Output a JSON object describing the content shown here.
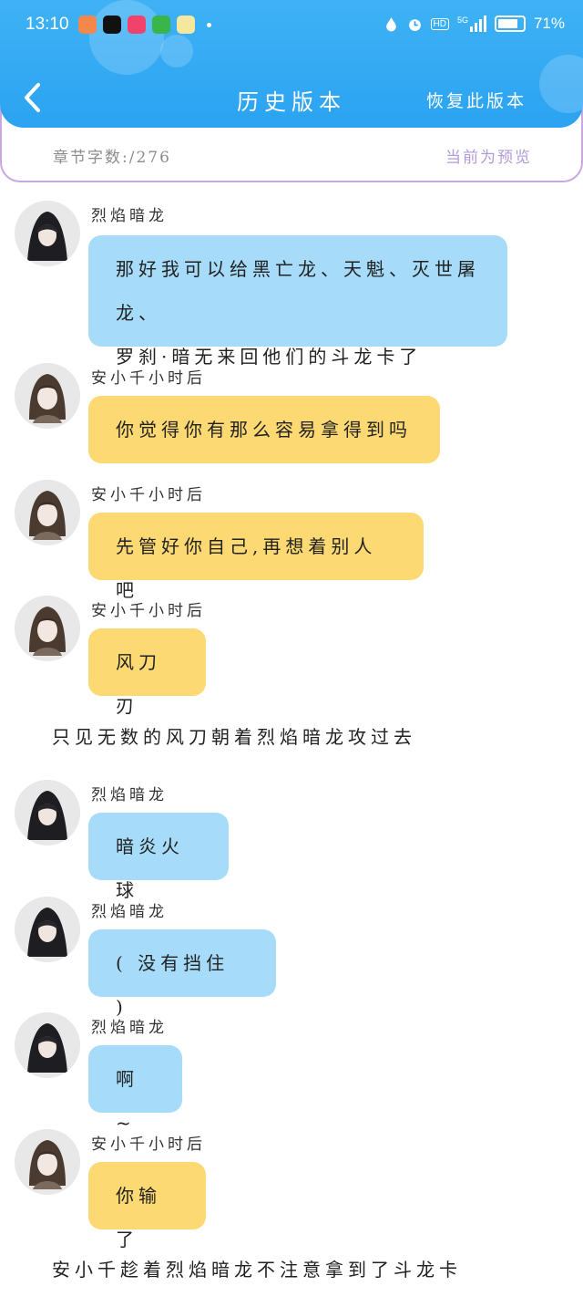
{
  "status_bar": {
    "time": "13:10",
    "battery_percent": "71%",
    "network": "5G",
    "hd_label": "HD",
    "battery_level": 0.71
  },
  "header": {
    "title": "历史版本",
    "restore_label": "恢复此版本",
    "back_icon": "chevron-left-icon"
  },
  "info": {
    "word_count": "章节字数:/276",
    "preview_label": "当前为预览"
  },
  "messages": [
    {
      "type": "chat",
      "speaker": "烈焰暗龙",
      "text": "那好我可以给黑亡龙、天魁、灭世屠龙、罗刹·暗无来回他们的斗龙卡了",
      "line1": "那好我可以给黑亡龙、天魁、灭世屠龙、",
      "line2": "罗刹·暗无来回他们的斗龙卡了",
      "color": "#a6dcfa"
    },
    {
      "type": "chat",
      "speaker": "安小千小时后",
      "text": "你觉得你有那么容易拿得到吗",
      "color": "#fcd972"
    },
    {
      "type": "chat",
      "speaker": "安小千小时后",
      "text": "先管好你自己,再想着别人吧",
      "color": "#fcd972"
    },
    {
      "type": "chat",
      "speaker": "安小千小时后",
      "text": "风刀刃",
      "color": "#fcd972"
    },
    {
      "type": "narration",
      "text": "只见无数的风刀朝着烈焰暗龙攻过去"
    },
    {
      "type": "chat",
      "speaker": "烈焰暗龙",
      "text": "暗炎火球",
      "color": "#a6dcfa"
    },
    {
      "type": "chat",
      "speaker": "烈焰暗龙",
      "text": "( 没有挡住 )",
      "color": "#a6dcfa"
    },
    {
      "type": "chat",
      "speaker": "烈焰暗龙",
      "text": "啊~",
      "color": "#a6dcfa"
    },
    {
      "type": "chat",
      "speaker": "安小千小时后",
      "text": "你输了",
      "color": "#fcd972"
    },
    {
      "type": "narration",
      "text": "安小千趁着烈焰暗龙不注意拿到了斗龙卡"
    }
  ]
}
